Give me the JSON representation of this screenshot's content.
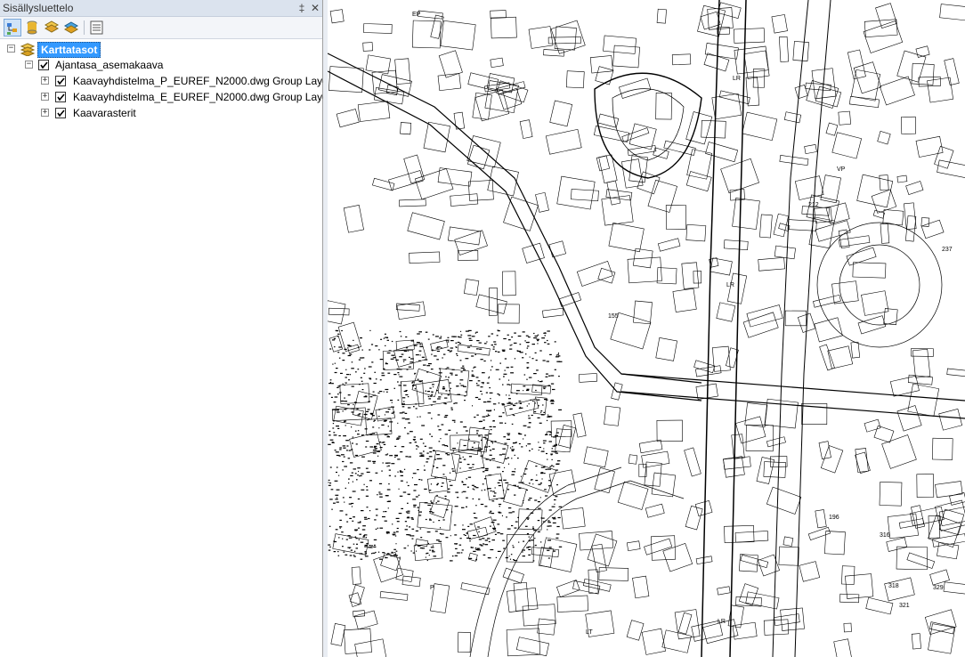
{
  "toc": {
    "title": "Sisällysluettelo",
    "pin_glyph": "‡",
    "close_glyph": "✕",
    "toolbar": [
      {
        "name": "list-by-drawing-order-icon",
        "active": true
      },
      {
        "name": "list-by-source-icon",
        "active": false
      },
      {
        "name": "list-by-visibility-icon",
        "active": false
      },
      {
        "name": "list-by-selection-icon",
        "active": false
      },
      {
        "name": "options-icon",
        "active": false
      }
    ],
    "root": {
      "label": "Karttatasot",
      "expanded": true
    },
    "group": {
      "label": "Ajantasa_asemakaava",
      "expanded": true,
      "checked": true
    },
    "layers": [
      {
        "label": "Kaavayhdistelma_P_EUREF_N2000.dwg Group Layer",
        "expanded": false,
        "checked": true
      },
      {
        "label": "Kaavayhdistelma_E_EUREF_N2000.dwg Group Layer",
        "expanded": false,
        "checked": true
      },
      {
        "label": "Kaavarasterit",
        "expanded": false,
        "checked": true
      }
    ]
  },
  "map": {
    "labels": [
      "LR",
      "LR",
      "LR",
      "LT",
      "P",
      "EP",
      "VP",
      "212",
      "196",
      "316",
      "318",
      "329",
      "321",
      "155",
      "237"
    ]
  }
}
